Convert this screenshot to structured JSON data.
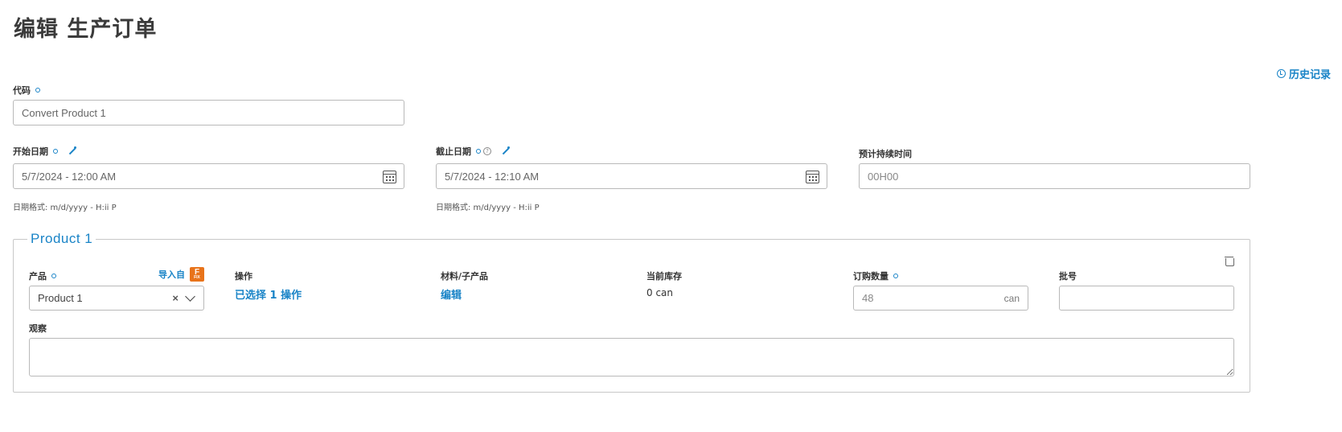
{
  "page": {
    "title": "编辑 生产订单",
    "history_label": "历史记录"
  },
  "code": {
    "label": "代码",
    "value": "Convert Product 1"
  },
  "start_date": {
    "label": "开始日期",
    "value": "5/7/2024 - 12:00 AM",
    "hint": "日期格式: m/d/yyyy - H:ii P"
  },
  "end_date": {
    "label": "截止日期",
    "value": "5/7/2024 - 12:10 AM",
    "hint": "日期格式: m/d/yyyy - H:ii P"
  },
  "duration": {
    "label": "预计持续时间",
    "placeholder": "00H00"
  },
  "product_block": {
    "legend": "Product 1",
    "product_label": "产品",
    "import_from_label": "导入自",
    "import_logo_letter": "F",
    "import_logo_sub": "FIX",
    "product_value": "Product 1",
    "operation_label": "操作",
    "operation_link": "已选择 1 操作",
    "materials_label": "材料/子产品",
    "materials_link": "编辑",
    "stock_label": "当前库存",
    "stock_value": "0 can",
    "order_qty_label": "订购数量",
    "order_qty_placeholder": "48",
    "order_qty_unit": "can",
    "batch_label": "批号",
    "notes_label": "观察"
  },
  "colors": {
    "accent": "#1a84c7",
    "logo": "#e8731a"
  },
  "icons": [
    "clock-icon",
    "magic-wand-icon",
    "calendar-icon",
    "help-icon",
    "trash-icon",
    "clear-icon",
    "chevron-down-icon"
  ]
}
